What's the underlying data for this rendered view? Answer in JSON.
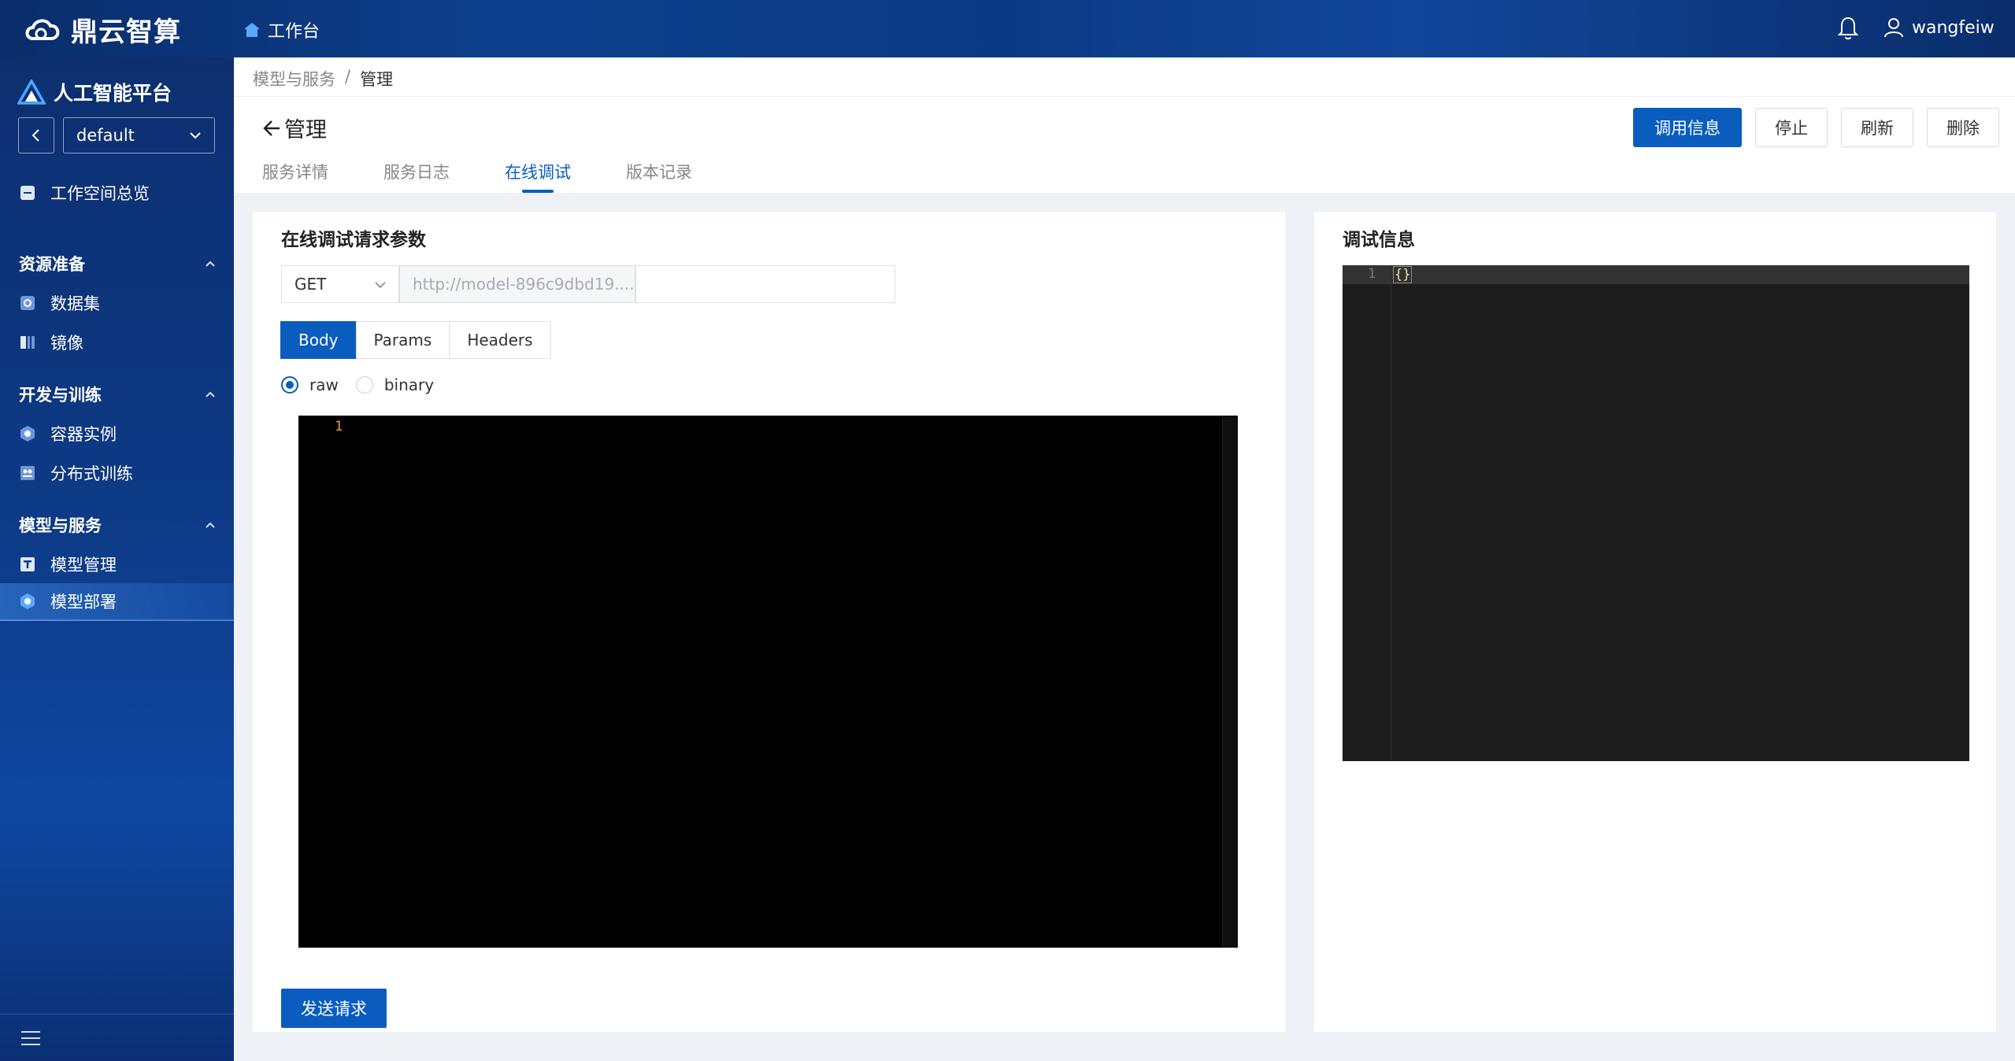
{
  "header": {
    "brand": "鼎云智算",
    "workbench": "工作台",
    "username": "wangfeiw"
  },
  "sidebar": {
    "platform": "人工智能平台",
    "workspace": "default",
    "overview": "工作空间总览",
    "sections": [
      {
        "title": "资源准备",
        "items": [
          "数据集",
          "镜像"
        ]
      },
      {
        "title": "开发与训练",
        "items": [
          "容器实例",
          "分布式训练"
        ]
      },
      {
        "title": "模型与服务",
        "items": [
          "模型管理",
          "模型部署"
        ]
      }
    ],
    "active_item": "模型部署"
  },
  "breadcrumb": [
    "模型与服务",
    "/",
    "管理"
  ],
  "page": {
    "title": "管理",
    "actions": [
      "调用信息",
      "停止",
      "刷新",
      "删除"
    ],
    "tabs": [
      "服务详情",
      "服务日志",
      "在线调试",
      "版本记录"
    ],
    "active_tab": "在线调试"
  },
  "request": {
    "title": "在线调试请求参数",
    "method": "GET",
    "url_placeholder": "http://model-896c9dbd19....",
    "path_value": "",
    "body_tabs": [
      "Body",
      "Params",
      "Headers"
    ],
    "active_body_tab": "Body",
    "radio_options": [
      "raw",
      "binary"
    ],
    "radio_selected": "raw",
    "editor_line": "1",
    "send_label": "发送请求"
  },
  "debug": {
    "title": "调试信息",
    "line": "1",
    "content": "{}"
  },
  "colors": {
    "primary": "#0a5dbf",
    "sidebar": "#0d3a86"
  }
}
